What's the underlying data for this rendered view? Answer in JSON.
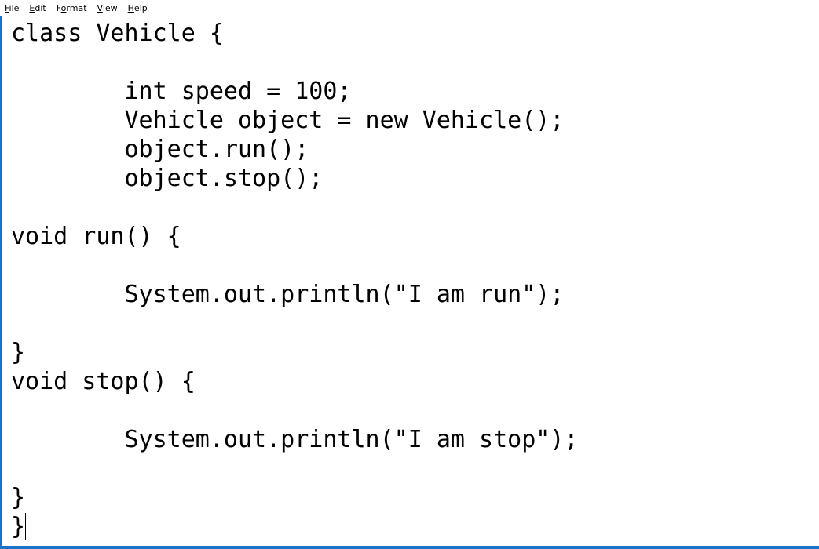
{
  "menu": [
    {
      "label": "File",
      "accel": "F",
      "rest": "ile"
    },
    {
      "label": "Edit",
      "accel": "E",
      "rest": "dit"
    },
    {
      "label": "Format",
      "accel": "o",
      "pre": "F",
      "rest": "rmat"
    },
    {
      "label": "View",
      "accel": "V",
      "rest": "iew"
    },
    {
      "label": "Help",
      "accel": "H",
      "rest": "elp"
    }
  ],
  "editor": {
    "content": "class Vehicle {\n\n\tint speed = 100;\n\tVehicle object = new Vehicle();\n\tobject.run();\n\tobject.stop();\n\nvoid run() {\n\n\tSystem.out.println(\"I am run\");\n\n}\nvoid stop() {\n\n\tSystem.out.println(\"I am stop\");\n\n}\n}"
  }
}
